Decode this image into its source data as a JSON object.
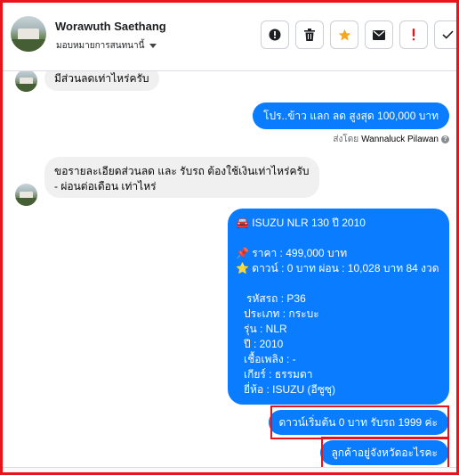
{
  "header": {
    "name": "Worawuth Saethang",
    "assign_label": "มอบหมายการสนทนานี้",
    "actions": {
      "spam": "mark-spam",
      "delete": "delete",
      "star": "star",
      "mail": "mark-unread",
      "important": "!",
      "done": "done"
    }
  },
  "messages": {
    "m1": "มีส่วนลดเท่าไหร่ครับ",
    "m2": "โปร..ข้าว แลก ลด สูงสุด 100,000 บาท",
    "sent_by_prefix": "ส่งโดย",
    "sent_by_name": "Wannaluck Pilawan",
    "m3_line1": "ขอรายละเอียดส่วนลด  และ รับรถ ต้องใช้เงินเท่าไหร่ครับ",
    "m3_line2": "- ผ่อนต่อเดือน เท่าไหร่",
    "car": {
      "title": "🚘 ISUZU NLR 130 ปี 2010",
      "price": "📌 ราคา : 499,000 บาท",
      "down": "⭐ ดาวน์ : 0 บาท ผ่อน : 10,028 บาท 84 งวด",
      "code": "รหัสรถ : P36",
      "type": "ประเภท : กระบะ",
      "model": "รุ่น : NLR",
      "year": "ปี : 2010",
      "fuel": "เชื้อเพลิง : -",
      "gear": "เกียร์ : ธรรมดา",
      "brand": "ยี่ห้อ : ISUZU (อีซูซุ)"
    },
    "m5": "ดาวน์เริ่มต้น 0 บาท รับรถ 1999 ค่ะ",
    "m6": "ลูกค้าอยู่จังหวัดอะไรคะ"
  },
  "colors": {
    "outgoing": "#0a7cff",
    "incoming": "#f0f0f0",
    "highlight": "#e8141a",
    "star": "#f5a623",
    "important": "#e8141a"
  }
}
